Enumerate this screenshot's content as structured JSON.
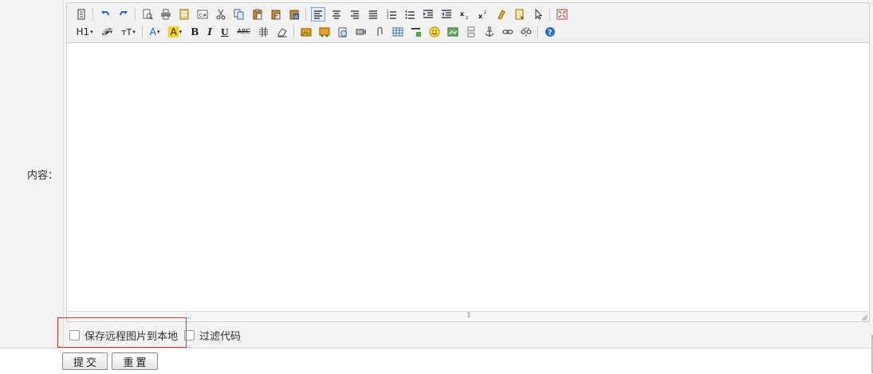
{
  "form": {
    "content_label": "内容："
  },
  "toolbar": {
    "row1": [
      {
        "icon": "source-code-icon"
      },
      {
        "sep": true
      },
      {
        "icon": "undo-icon"
      },
      {
        "icon": "redo-icon"
      },
      {
        "sep": true
      },
      {
        "icon": "preview-icon"
      },
      {
        "icon": "print-icon"
      },
      {
        "icon": "template-icon"
      },
      {
        "icon": "code-icon"
      },
      {
        "icon": "cut-icon"
      },
      {
        "icon": "copy-icon"
      },
      {
        "icon": "paste-icon"
      },
      {
        "icon": "paste-text-icon"
      },
      {
        "icon": "paste-word-icon"
      },
      {
        "sep": true
      },
      {
        "icon": "align-left-icon",
        "active": true
      },
      {
        "icon": "align-center-icon"
      },
      {
        "icon": "align-right-icon"
      },
      {
        "icon": "align-justify-icon"
      },
      {
        "icon": "ordered-list-icon"
      },
      {
        "icon": "unordered-list-icon"
      },
      {
        "icon": "indent-icon"
      },
      {
        "icon": "outdent-icon"
      },
      {
        "icon": "subscript-icon"
      },
      {
        "icon": "superscript-icon"
      },
      {
        "icon": "clear-format-icon"
      },
      {
        "icon": "select-all-icon"
      },
      {
        "icon": "select-cursor-icon"
      },
      {
        "sep": true
      },
      {
        "icon": "fullscreen-icon"
      }
    ],
    "row2": [
      {
        "icon": "heading-icon",
        "text": "H1",
        "caret": true
      },
      {
        "icon": "font-family-icon",
        "text": "𝓕",
        "caret": true
      },
      {
        "icon": "font-size-icon",
        "text": "тT",
        "caret": true
      },
      {
        "sep": true
      },
      {
        "icon": "text-color-icon",
        "text": "A",
        "caret": true
      },
      {
        "icon": "highlight-color-icon",
        "text": "A",
        "caret": true
      },
      {
        "icon": "bold-icon",
        "text": "B"
      },
      {
        "icon": "italic-icon",
        "text": "I"
      },
      {
        "icon": "underline-icon",
        "text": "U"
      },
      {
        "icon": "strikethrough-icon",
        "text": "ABC"
      },
      {
        "icon": "horizontal-rule-icon"
      },
      {
        "icon": "eraser-icon"
      },
      {
        "sep": true
      },
      {
        "icon": "image-icon"
      },
      {
        "icon": "multi-image-icon"
      },
      {
        "icon": "flash-icon"
      },
      {
        "icon": "media-icon"
      },
      {
        "icon": "attachment-icon"
      },
      {
        "icon": "table-icon"
      },
      {
        "icon": "insert-icon"
      },
      {
        "icon": "emoticon-icon"
      },
      {
        "icon": "map-icon"
      },
      {
        "icon": "page-break-icon"
      },
      {
        "icon": "anchor-icon"
      },
      {
        "icon": "link-icon"
      },
      {
        "icon": "unlink-icon"
      },
      {
        "sep": true
      },
      {
        "icon": "help-icon"
      }
    ]
  },
  "options": {
    "save_remote_images": "保存远程图片到本地",
    "filter_code": "过滤代码"
  },
  "buttons": {
    "submit": "提交",
    "reset": "重置"
  },
  "colors": {
    "highlight_box": "#e03030",
    "active_button": "#7aa2d6",
    "highlight_color_fill": "#ffd200"
  }
}
